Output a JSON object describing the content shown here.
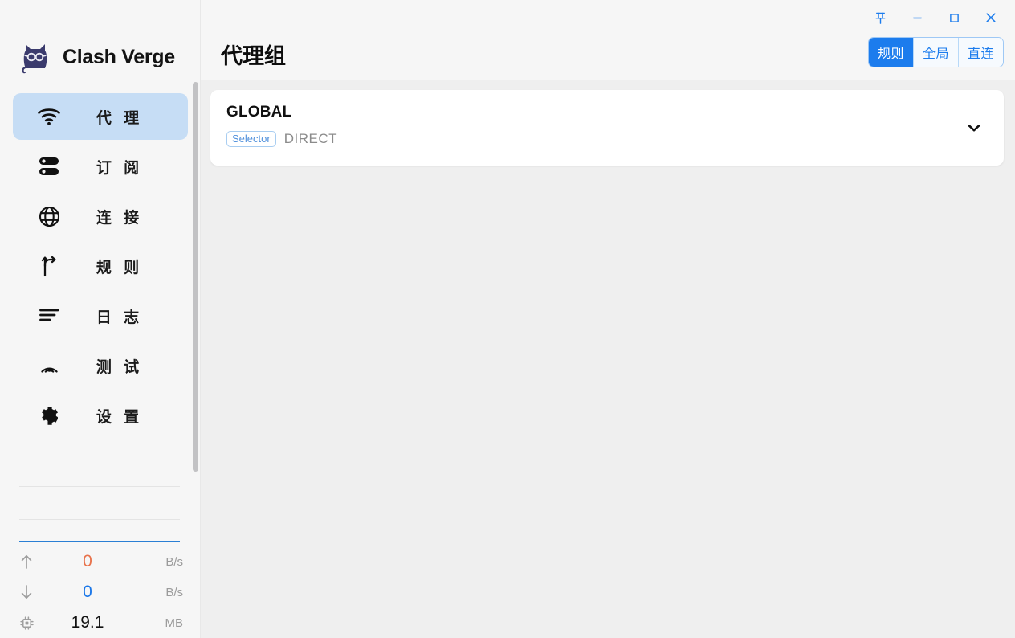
{
  "app": {
    "brand_name": "Clash Verge",
    "logo_icon": "cat-logo-icon"
  },
  "sidebar": {
    "items": [
      {
        "label": "代 理",
        "icon": "wifi-icon",
        "active": true
      },
      {
        "label": "订 阅",
        "icon": "server-icon",
        "active": false
      },
      {
        "label": "连 接",
        "icon": "globe-icon",
        "active": false
      },
      {
        "label": "规 则",
        "icon": "route-fork-icon",
        "active": false
      },
      {
        "label": "日 志",
        "icon": "list-lines-icon",
        "active": false
      },
      {
        "label": "测 试",
        "icon": "radar-signal-icon",
        "active": false
      },
      {
        "label": "设 置",
        "icon": "gear-icon",
        "active": false
      }
    ],
    "stats": [
      {
        "icon": "arrow-up-icon",
        "value": "0",
        "unit": "B/s",
        "kind": "up"
      },
      {
        "icon": "arrow-down-icon",
        "value": "0",
        "unit": "B/s",
        "kind": "down"
      },
      {
        "icon": "memory-chip-icon",
        "value": "19.1",
        "unit": "MB",
        "kind": "mem"
      }
    ]
  },
  "header": {
    "title": "代理组",
    "window_controls": [
      {
        "name": "pin-icon",
        "glyph": "pin"
      },
      {
        "name": "minimize-icon",
        "glyph": "minimize"
      },
      {
        "name": "maximize-icon",
        "glyph": "maximize"
      },
      {
        "name": "close-icon",
        "glyph": "close"
      }
    ],
    "modes": [
      {
        "label": "规则",
        "selected": true
      },
      {
        "label": "全局",
        "selected": false
      },
      {
        "label": "直连",
        "selected": false
      }
    ]
  },
  "main": {
    "groups": [
      {
        "name": "GLOBAL",
        "type_badge": "Selector",
        "current": "DIRECT",
        "expand_icon": "chevron-down-icon"
      }
    ]
  },
  "colors": {
    "accent": "#1c7ced",
    "active_nav_bg": "#c6ddf5",
    "upload": "#e8724b",
    "download": "#1976e8",
    "sidebar_bg": "#f6f6f6",
    "content_bg": "#efefef"
  }
}
